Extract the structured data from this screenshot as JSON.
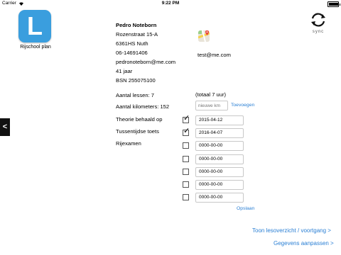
{
  "statusbar": {
    "carrier": "Carrier",
    "time": "9:22 PM",
    "battery_level": 0.95
  },
  "app": {
    "logo_letter": "L",
    "logo_color": "#3a9ede",
    "name": "Rijschool plan",
    "sync_label": "sync"
  },
  "student": {
    "name": "Pedro Noteborn",
    "street": "Rozenstraat 15-A",
    "postal_city": "6361HS Nuth",
    "phone": "06-14691406",
    "email": "pedronoteborn@me.com",
    "age": "41 jaar",
    "bsn": "BSN 255075100",
    "secondary_email": "test@me.com"
  },
  "stats": {
    "lessons": "Aantal lessen: 7",
    "total_hours": "(totaal 7 uur)",
    "kilometers": "Aantal kilometers: 152",
    "km_placeholder": "nieuwe km",
    "add_label": "Toevoegen"
  },
  "exams": {
    "theory_label": "Theorie behaald op",
    "interim_label": "Tussentijdse toets",
    "driving_label": "Rijexamen",
    "rows": [
      {
        "checked": true,
        "date": "2015-04-12"
      },
      {
        "checked": true,
        "date": "2016-04-07"
      },
      {
        "checked": false,
        "date": "0000-00-00"
      },
      {
        "checked": false,
        "date": "0000-00-00"
      },
      {
        "checked": false,
        "date": "0000-00-00"
      },
      {
        "checked": false,
        "date": "0000-00-00"
      },
      {
        "checked": false,
        "date": "0000-00-00"
      }
    ],
    "save_label": "Opslaan"
  },
  "links": {
    "lesson_overview": "Toon lesoverzicht / voortgang >",
    "edit_details": "Gegevens aanpassen >"
  },
  "side_tab": {
    "label": "<"
  },
  "colors": {
    "accent": "#2a7fd4",
    "logo": "#3a9ede"
  }
}
